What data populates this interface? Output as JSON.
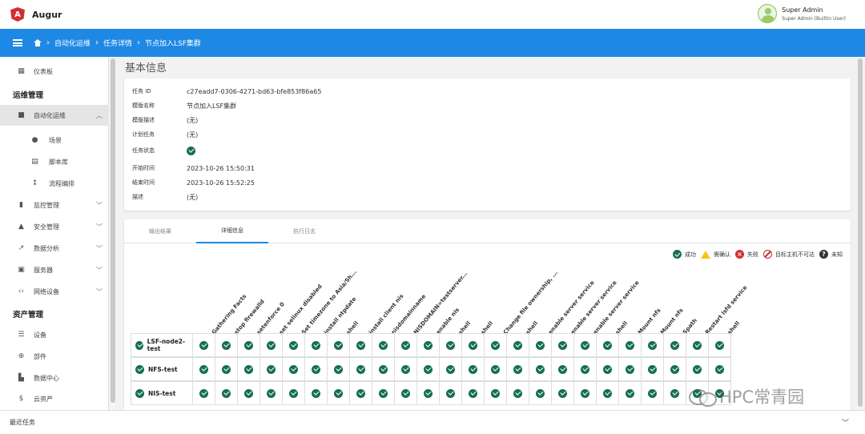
{
  "app": {
    "name": "Augur"
  },
  "user": {
    "name": "Super Admin",
    "subtitle": "Super Admin (Builtin User)"
  },
  "breadcrumb": [
    "自动化运维",
    "任务详情",
    "节点加入LSF集群"
  ],
  "sidebar": {
    "dashboard": "仪表板",
    "section_ops": "运维管理",
    "automation": "自动化运维",
    "automation_children": [
      "场景",
      "脚本库",
      "流程编排"
    ],
    "monitor": "监控管理",
    "security": "安全管理",
    "analytics": "数据分析",
    "servers": "服务器",
    "network": "网络设备",
    "section_assets": "资产管理",
    "devices": "设备",
    "parts": "部件",
    "datacenter": "数据中心",
    "cloud": "云资产"
  },
  "recent_tasks": "最近任务",
  "page_title": "基本信息",
  "info": {
    "task_id_label": "任务 ID",
    "task_id": "c27eadd7-0306-4271-bd63-bfe853f86a65",
    "template_name_label": "模版名称",
    "template_name": "节点加入LSF集群",
    "template_desc_label": "模版描述",
    "template_desc": "(无)",
    "scheduled_label": "计划任务",
    "scheduled": "(无)",
    "status_label": "任务状态",
    "status": "success",
    "start_label": "开始时间",
    "start": "2023-10-26 15:50:31",
    "end_label": "结束时间",
    "end": "2023-10-26 15:52:25",
    "desc_label": "描述",
    "desc": "(无)"
  },
  "tabs": [
    "输出结果",
    "详细信息",
    "执行日志"
  ],
  "active_tab": 1,
  "legend": [
    "成功",
    "需确认",
    "失败",
    "目标主机不可达",
    "未知"
  ],
  "columns": [
    "Gathering Facts",
    "stop firewalld",
    "setenforce 0",
    "set selinux disabled",
    "Set timezone to Asia/Sh...",
    "install ntpdate",
    "shell",
    "install client nis",
    "nisdomainname",
    "NISDOMAIN=testserver...",
    "enable nis",
    "shell",
    "shell",
    "Change file ownership, ...",
    "shell",
    "enable server service",
    "enable server service",
    "enable server service",
    "shell",
    "Mount nfs",
    "Mount nfs",
    "Spath",
    "Restart lsfd service",
    "shell"
  ],
  "hosts": [
    "LSF-node2-test",
    "NFS-test",
    "NIS-test"
  ],
  "watermark": "HPC常青园"
}
